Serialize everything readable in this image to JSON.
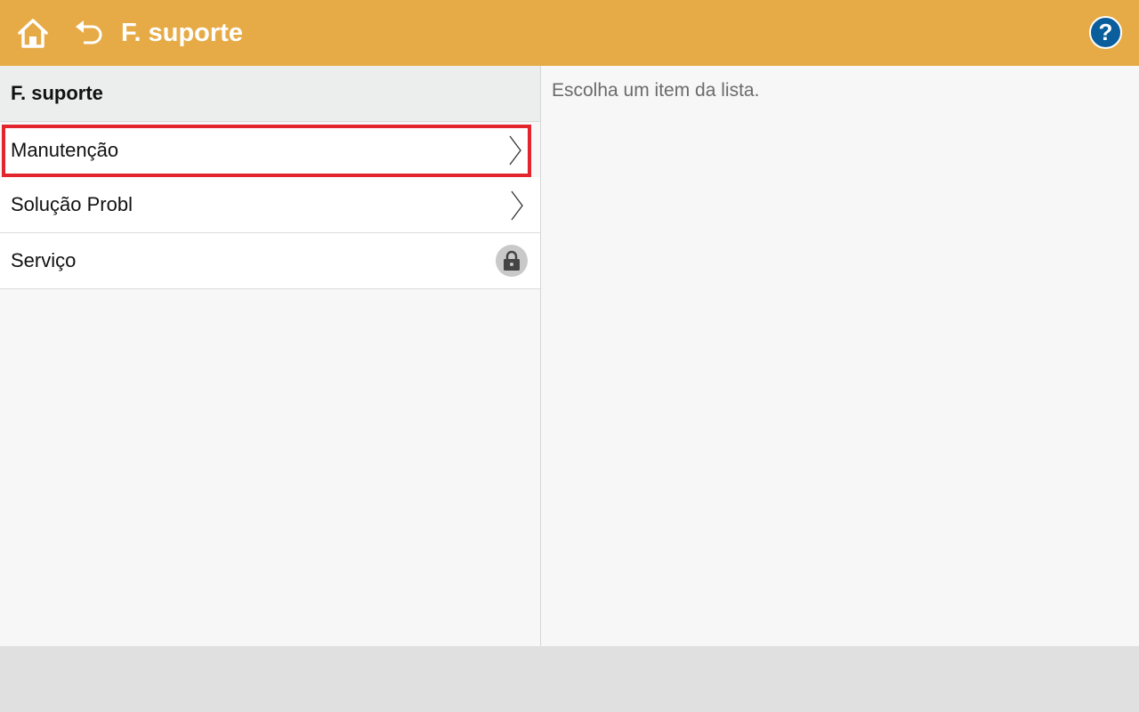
{
  "header": {
    "title": "F. suporte",
    "home_icon": "home-icon",
    "back_icon": "back-arrow-icon",
    "help_icon": "help-icon",
    "help_glyph": "?",
    "bar_color": "#e6ab46"
  },
  "left_panel": {
    "title": "F. suporte",
    "items": [
      {
        "label": "Manutenção",
        "icon": "chevron-right-icon",
        "selected": true
      },
      {
        "label": "Solução Probl",
        "icon": "chevron-right-icon",
        "selected": false
      },
      {
        "label": "Serviço",
        "icon": "lock-icon",
        "selected": false
      }
    ]
  },
  "right_panel": {
    "hint": "Escolha um item da lista."
  },
  "colors": {
    "selection_outline": "#e3262d",
    "help_button": "#0a5e9b"
  }
}
